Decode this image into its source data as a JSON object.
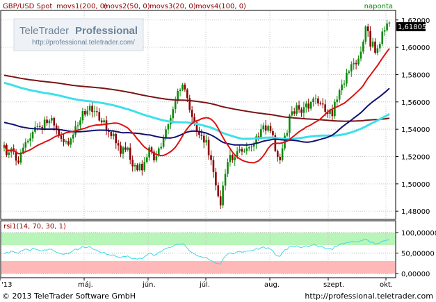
{
  "header": {
    "symbol": "GBP/USD Spot",
    "indicators": [
      {
        "label": "movs1(200, 0)",
        "color": "#8b0000"
      },
      {
        "label": "movs2(50, 0)",
        "color": "#8b0000"
      },
      {
        "label": "movs3(20, 0)",
        "color": "#8b0000"
      },
      {
        "label": "movs4(100, 0)",
        "color": "#8b0000"
      }
    ],
    "interval": "naponta"
  },
  "watermark": {
    "brand_a": "TeleTrader",
    "brand_b": "Professional",
    "url": "http://professional.teletrader.com/"
  },
  "last_price_label": "1,61805",
  "rsi_header": "rsi1(14, 70, 30, 1)",
  "footer": {
    "copyright": "© 2013  TeleTrader Software GmbH",
    "url": "http://professional.teletrader.com"
  },
  "colors": {
    "up_candle": "#0a8a0a",
    "down_candle": "#8b0000",
    "sma200": "#7a1414",
    "sma50": "#101070",
    "sma20": "#dd1111",
    "sma100": "#3ee0e8",
    "rsi_line": "#3fd8e6",
    "overbought_zone": "#b8f5b8",
    "oversold_zone": "#ffb8b8"
  },
  "chart_data": [
    {
      "type": "candlestick",
      "title": "GBP/USD Spot",
      "x_tick_labels": [
        "'13",
        "máj.",
        "jún.",
        "júl.",
        "aug.",
        "szept.",
        "okt."
      ],
      "y_tick_labels": [
        "1,62000",
        "1,60000",
        "1,58000",
        "1,56000",
        "1,54000",
        "1,52000",
        "1,50000",
        "1,48000"
      ],
      "ylim": [
        1.474,
        1.627
      ],
      "grid": true,
      "last_value": 1.61805,
      "closes": [
        1.5285,
        1.5213,
        1.523,
        1.526,
        1.5237,
        1.517,
        1.5155,
        1.523,
        1.5265,
        1.5305,
        1.5315,
        1.5333,
        1.5381,
        1.5417,
        1.5423,
        1.5417,
        1.5407,
        1.547,
        1.5445,
        1.5464,
        1.5482,
        1.5428,
        1.5401,
        1.5352,
        1.533,
        1.5306,
        1.5313,
        1.5287,
        1.5332,
        1.536,
        1.5422,
        1.5429,
        1.5465,
        1.5533,
        1.5508,
        1.5536,
        1.5571,
        1.5527,
        1.5532,
        1.5526,
        1.5464,
        1.5451,
        1.5465,
        1.5391,
        1.5381,
        1.5349,
        1.5366,
        1.5298,
        1.5281,
        1.522,
        1.5267,
        1.5249,
        1.5265,
        1.5177,
        1.5128,
        1.5137,
        1.51,
        1.5147,
        1.5099,
        1.516,
        1.5194,
        1.5267,
        1.5236,
        1.5172,
        1.5205,
        1.526,
        1.5271,
        1.5339,
        1.5398,
        1.5436,
        1.5481,
        1.5547,
        1.5606,
        1.568,
        1.5689,
        1.5727,
        1.5691,
        1.5628,
        1.5542,
        1.549,
        1.5449,
        1.5387,
        1.5359,
        1.5352,
        1.5303,
        1.5322,
        1.521,
        1.5175,
        1.5087,
        1.4989,
        1.491,
        1.4843,
        1.4987,
        1.5073,
        1.516,
        1.5212,
        1.5174,
        1.5195,
        1.524,
        1.5255,
        1.5236,
        1.524,
        1.5261,
        1.5268,
        1.5273,
        1.5295,
        1.5348,
        1.5337,
        1.54,
        1.5428,
        1.539,
        1.5424,
        1.5386,
        1.5356,
        1.5241,
        1.5197,
        1.5174,
        1.526,
        1.5353,
        1.5372,
        1.5501,
        1.5531,
        1.5514,
        1.5576,
        1.5545,
        1.552,
        1.5562,
        1.5588,
        1.5551,
        1.5599,
        1.5624,
        1.5626,
        1.5589,
        1.5588,
        1.5582,
        1.5528,
        1.5512,
        1.5539,
        1.5496,
        1.56,
        1.5617,
        1.5685,
        1.5727,
        1.5734,
        1.5813,
        1.5823,
        1.5876,
        1.5885,
        1.5876,
        1.5917,
        1.5968,
        1.6041,
        1.6152,
        1.6118,
        1.6005,
        1.6042,
        1.596,
        1.5993,
        1.6025,
        1.6115,
        1.6125,
        1.6175,
        1.6181
      ]
    },
    {
      "type": "line",
      "title": "rsi1(14, 70, 30, 1)",
      "y_tick_labels": [
        "100,00000",
        "50,00000",
        "0,00000"
      ],
      "ylim": [
        0,
        100
      ],
      "overbought": 70,
      "oversold": 30,
      "values": [
        48,
        52,
        50,
        55,
        53,
        51,
        49,
        55,
        57,
        60,
        58,
        56,
        62,
        60,
        58,
        56,
        55,
        58,
        57,
        60,
        59,
        55,
        52,
        50,
        48,
        47,
        49,
        48,
        52,
        56,
        60,
        58,
        62,
        66,
        63,
        64,
        66,
        61,
        58,
        57,
        53,
        50,
        52,
        47,
        46,
        44,
        46,
        42,
        40,
        38,
        42,
        41,
        43,
        38,
        36,
        37,
        35,
        38,
        36,
        41,
        45,
        50,
        48,
        44,
        47,
        52,
        53,
        58,
        61,
        63,
        64,
        67,
        70,
        72,
        71,
        73,
        69,
        62,
        55,
        51,
        48,
        44,
        42,
        41,
        38,
        40,
        34,
        32,
        28,
        25,
        24,
        23,
        35,
        42,
        48,
        51,
        48,
        50,
        53,
        54,
        52,
        53,
        55,
        55,
        56,
        57,
        61,
        59,
        63,
        65,
        61,
        63,
        59,
        56,
        46,
        43,
        42,
        51,
        58,
        59,
        66,
        67,
        65,
        68,
        65,
        63,
        66,
        68,
        65,
        69,
        70,
        70,
        66,
        66,
        65,
        61,
        60,
        62,
        58,
        66,
        67,
        71,
        73,
        73,
        76,
        76,
        78,
        78,
        77,
        78,
        80,
        82,
        84,
        81,
        76,
        77,
        72,
        73,
        75,
        79,
        80,
        82,
        82
      ]
    }
  ]
}
